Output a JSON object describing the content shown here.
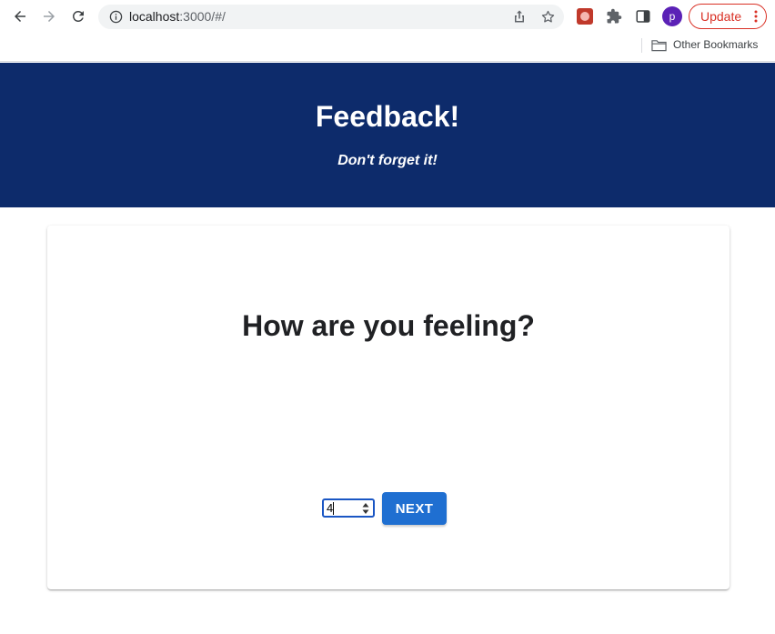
{
  "browser": {
    "url_host": "localhost",
    "url_rest": ":3000/#/",
    "profile_initial": "p",
    "update_label": "Update",
    "bookmarks": {
      "other_label": "Other Bookmarks"
    }
  },
  "header": {
    "title": "Feedback!",
    "subtitle": "Don't forget it!"
  },
  "card": {
    "question": "How are you feeling?",
    "rating_value": "4",
    "next_label": "NEXT"
  },
  "colors": {
    "header_bg": "#0d2b6b",
    "accent": "#1f6fd1",
    "update_red": "#d93025"
  }
}
